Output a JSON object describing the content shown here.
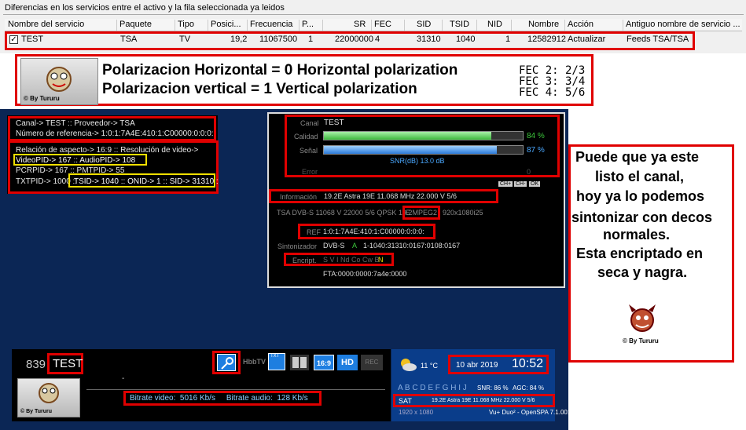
{
  "top": {
    "title": "Diferencias en los servicios entre el activo y la fila seleccionada ya leidos",
    "columns": [
      "Nombre del servicio",
      "Paquete",
      "Tipo",
      "Posici...",
      "Frecuencia",
      "P...",
      "SR",
      "FEC",
      "SID",
      "TSID",
      "NID",
      "Nombre",
      "Acción",
      "Antiguo nombre de servicio ..."
    ],
    "row": {
      "check": "✓",
      "name": "TEST",
      "package": "TSA",
      "type": "TV",
      "position": "19,2",
      "frequency": "11067500",
      "p": "1",
      "sr": "22000000",
      "fec": "4",
      "sid": "31310",
      "tsid": "1040",
      "nid": "1",
      "nombre": "12582912",
      "accion": "Actualizar",
      "antiguo": "Feeds TSA/TSA"
    }
  },
  "banner": {
    "line1": "Polarizacion  Horizontal = 0  Horizontal polarization",
    "line2": "Polarizacion  vertical      = 1  Vertical polarization",
    "fec": [
      "FEC 2: 2/3",
      "FEC 3: 3/4",
      "FEC 4: 5/6"
    ],
    "logo": "© By Tururu"
  },
  "info": {
    "l1": "Canal-> TEST :: Proveedor-> TSA",
    "l2": "Número de referencia-> 1:0:1:7A4E:410:1:C00000:0:0:0:",
    "l3": "Relación de aspecto-> 16:9 :: Resolución de video->",
    "l4": "VideoPID-> 167 :: AudioPID-> 108",
    "l5": "PCRPID-> 167 :: PMTPID-> 55",
    "l6a": "TXTPID-> 1000 ::",
    "l6b": "TSID-> 1040 :: ONID-> 1 :: SID-> 31310 :"
  },
  "tech": {
    "canal_label": "Canal",
    "canal": "TEST",
    "calidad_label": "Calidad",
    "calidad_pct": "84 %",
    "calidad_value": 0.84,
    "senal_label": "Señal",
    "senal_pct": "87 %",
    "senal_value": 0.87,
    "snr": "SNR(dB) 13.0 dB",
    "error_label": "Error",
    "error_value": "0",
    "btn1": "CH+",
    "btn2": "CH-",
    "btn3": "OK",
    "info_label": "Información",
    "info": "19.2E Astra 19E 11.068 MHz 22.000 V 5/6",
    "tsa_line": "TSA DVB-S 11068 V 22000 5/6 QPSK 19.2",
    "mpeg": "E MPEG2",
    "res": "920x1080i25",
    "ref_label": "REF",
    "ref": "1:0:1:7A4E:410:1:C00000:0:0:0:",
    "sint_label": "Sintonizador",
    "sint1": "DVB-S",
    "sint2": "A",
    "sint3": "1-1040:31310:0167:0108:0167",
    "encr_label": "Encript.",
    "encr": "S V I Nd Co Cw B",
    "encr_n": "N",
    "fta": "FTA:0000:0000:7a4e:0000"
  },
  "bottom": {
    "num": "839",
    "name": "TEST",
    "dash": "-",
    "bitrate": "Bitrate video:  5016 Kb/s     Bitrate audio:  128 Kb/s",
    "icons": [
      "HbbTV",
      "TXT",
      "16:9",
      "HD",
      "REC"
    ],
    "temp": "11 °C",
    "date": "10 abr 2019",
    "time": "10:52",
    "letters": "A B C D E F G H I J",
    "snr": "SNR: 86 %",
    "agc": "AGC: 84 %",
    "sat": "SAT",
    "sat_info": "19.2E Astra 19E 11.068 MHz 22.000 V 5/6",
    "res": "1920 x 1080",
    "box": "Vu+ Duo² - OpenSPA 7.1.001",
    "logo": "© By Tururu"
  },
  "note": {
    "lines": [
      "Puede que ya este",
      "listo el canal,",
      "hoy ya lo podemos",
      "sintonizar con decos",
      "normales.",
      "Esta encriptado en",
      "seca y nagra."
    ],
    "logo": "© By Tururu"
  }
}
